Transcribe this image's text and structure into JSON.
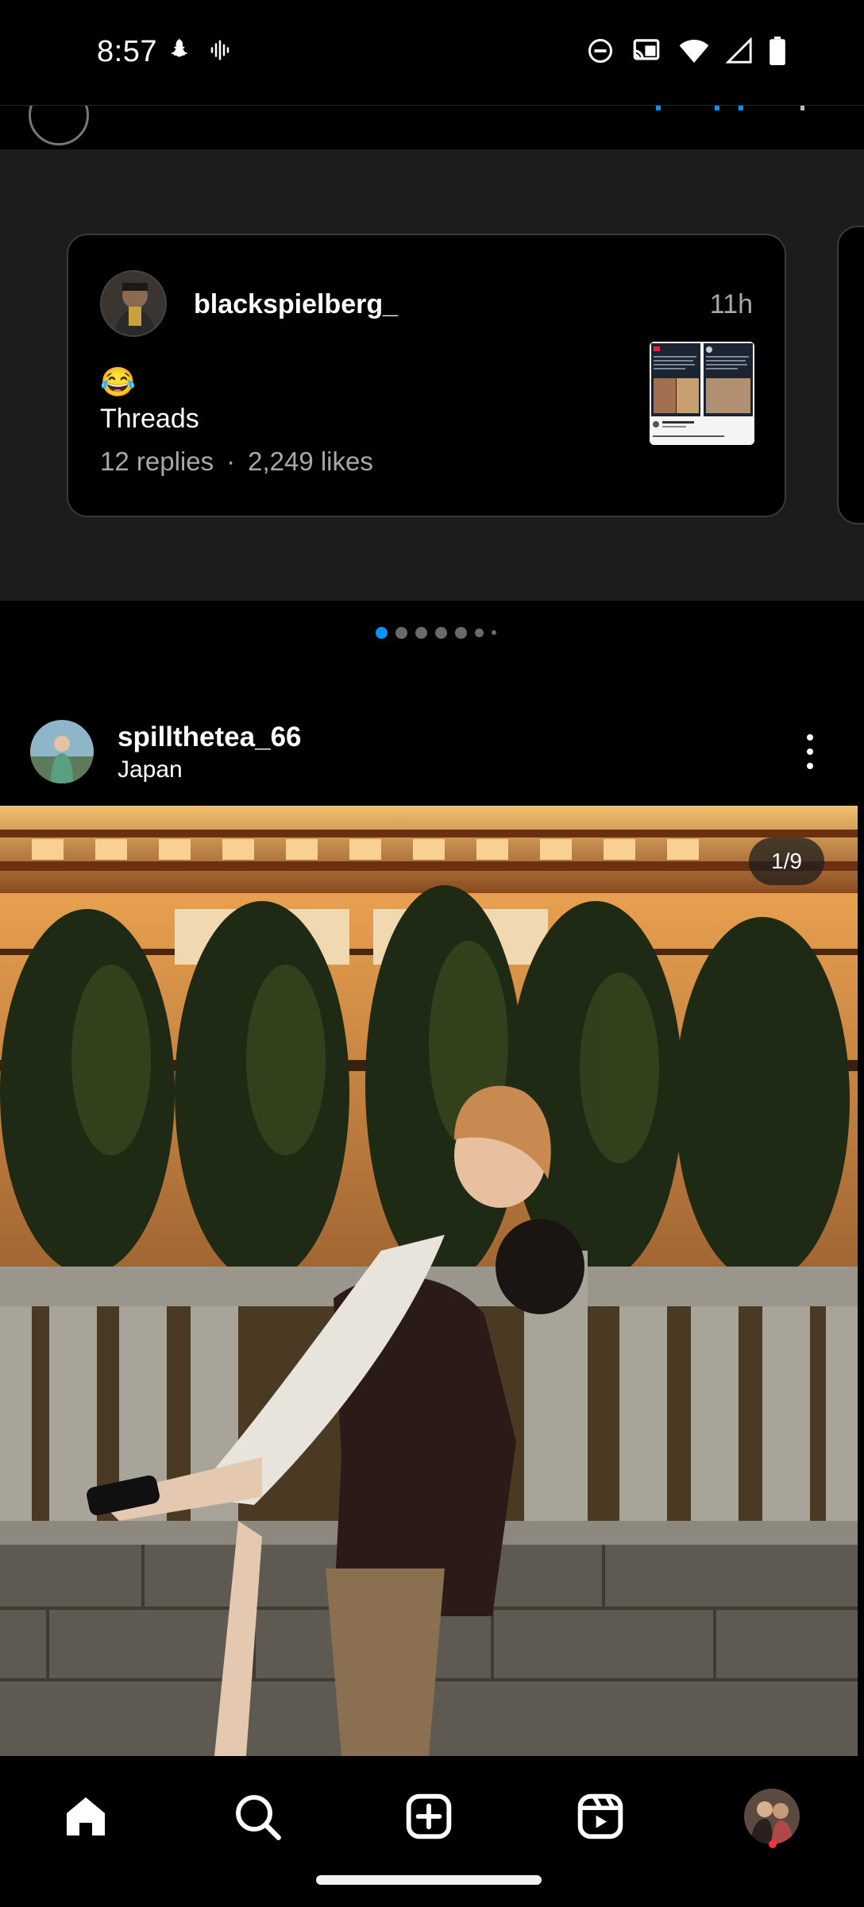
{
  "status_bar": {
    "time": "8:57",
    "left_icons": [
      "snapchat-icon",
      "voice-icon"
    ],
    "right_icons": [
      "dnd-icon",
      "cast-icon",
      "wifi-icon",
      "signal-icon",
      "battery-icon"
    ]
  },
  "threads_card": {
    "username": "blackspielberg_",
    "time": "11h",
    "emoji": "😂",
    "text": "Threads",
    "replies": "12 replies",
    "separator": "·",
    "likes": "2,249 likes"
  },
  "carousel": {
    "dots": 7,
    "active_index": 0
  },
  "post": {
    "username": "spillthetea_66",
    "location": "Japan",
    "counter": "1/9"
  },
  "bottom_nav": {
    "items": [
      "home-icon",
      "search-icon",
      "create-icon",
      "reels-icon",
      "profile-avatar"
    ],
    "active": "home-icon",
    "notification_dot_color": "#ff3040"
  },
  "colors": {
    "accent_blue": "#0095f6",
    "muted_text": "#a8a8a8",
    "section_bg": "#1c1c1c"
  }
}
